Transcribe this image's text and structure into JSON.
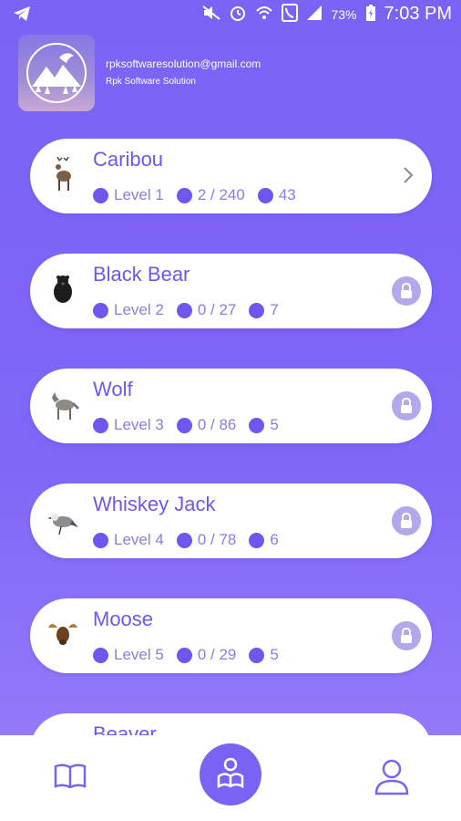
{
  "status_bar": {
    "battery": "73%",
    "time": "7:03 PM"
  },
  "profile": {
    "email": "rpksoftwaresolution@gmail.com",
    "company": "Rpk Software Solution"
  },
  "levels": [
    {
      "title": "Caribou",
      "level": "Level 1",
      "progress": "2 / 240",
      "count": "43",
      "state": "open",
      "icon": "caribou-icon"
    },
    {
      "title": "Black Bear",
      "level": "Level 2",
      "progress": "0 / 27",
      "count": "7",
      "state": "locked",
      "icon": "black-bear-icon"
    },
    {
      "title": "Wolf",
      "level": "Level 3",
      "progress": "0 / 86",
      "count": "5",
      "state": "locked",
      "icon": "wolf-icon"
    },
    {
      "title": "Whiskey Jack",
      "level": "Level 4",
      "progress": "0 / 78",
      "count": "6",
      "state": "locked",
      "icon": "whiskey-jack-icon"
    },
    {
      "title": "Moose",
      "level": "Level 5",
      "progress": "0 / 29",
      "count": "5",
      "state": "locked",
      "icon": "moose-icon"
    }
  ],
  "partial_card": {
    "title": "Beaver"
  },
  "bottom_nav": {
    "left": "book-icon",
    "center": "reader-icon",
    "right": "user-icon"
  },
  "colors": {
    "accent": "#6e57ef",
    "background": "#7b63f6",
    "lock": "#b5a7ec"
  }
}
